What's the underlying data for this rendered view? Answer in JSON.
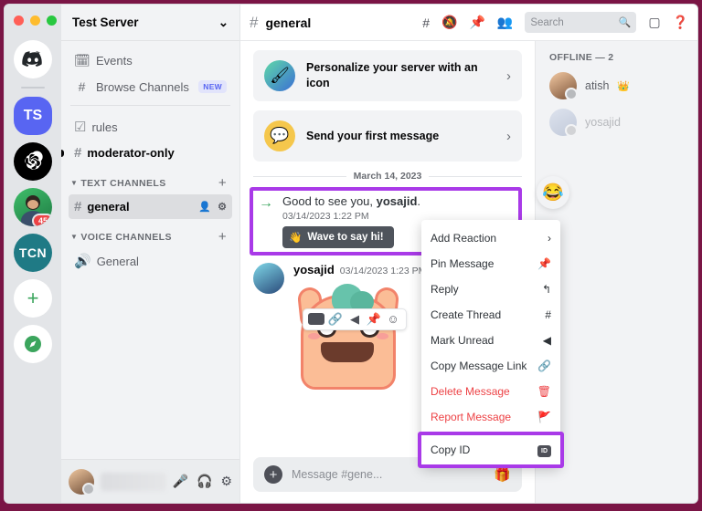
{
  "window": {
    "traffic_lights": [
      "close",
      "minimize",
      "maximize"
    ]
  },
  "rail": {
    "servers": [
      {
        "name": "discord-home",
        "label": "",
        "icon": "discord-logo"
      },
      {
        "name": "test-server",
        "label": "TS",
        "icon": "server-ts"
      },
      {
        "name": "chatgpt-server",
        "label": "",
        "icon": "openai-logo"
      },
      {
        "name": "avatar-server",
        "label": "",
        "icon": "avatar",
        "badge": "45"
      },
      {
        "name": "tcn-server",
        "label": "TCN",
        "icon": "server-tcn"
      },
      {
        "name": "add-server",
        "label": "+",
        "icon": "plus"
      },
      {
        "name": "explore-servers",
        "label": "",
        "icon": "compass"
      }
    ]
  },
  "sidebar": {
    "server_name": "Test Server",
    "nav": [
      {
        "label": "Events",
        "icon": "calendar-icon"
      },
      {
        "label": "Browse Channels",
        "icon": "browse-channels-icon",
        "tag": "NEW"
      }
    ],
    "top_channels": [
      {
        "label": "rules",
        "icon": "rules-icon",
        "unread": false
      },
      {
        "label": "moderator-only",
        "icon": "hash-lock-icon",
        "unread": true
      }
    ],
    "categories": [
      {
        "label": "TEXT CHANNELS",
        "channels": [
          {
            "label": "general",
            "icon": "hash-icon",
            "active": true
          }
        ]
      },
      {
        "label": "VOICE CHANNELS",
        "channels": [
          {
            "label": "General",
            "icon": "speaker-icon",
            "active": false
          }
        ]
      }
    ],
    "user_panel": {
      "username": "",
      "icons": [
        "mic-icon",
        "headphones-icon",
        "settings-icon"
      ]
    }
  },
  "topbar": {
    "hash": "#",
    "channel": "general",
    "icons": [
      "threads-icon",
      "notifications-off-icon",
      "pinned-messages-icon",
      "members-icon"
    ],
    "search_placeholder": "Search",
    "right_icons": [
      "inbox-icon",
      "help-icon"
    ]
  },
  "onboarding": [
    {
      "title": "Personalize your server with an icon",
      "icon": "paint-brush-icon"
    },
    {
      "title": "Send your first message",
      "icon": "chat-emoji-icon"
    }
  ],
  "messages": {
    "date_divider": "March 14, 2023",
    "system": {
      "text_prefix": "Good to see you, ",
      "username": "yosajid",
      "text_suffix": ".",
      "timestamp": "03/14/2023 1:22 PM",
      "button_label": "Wave to say hi!",
      "arrow_icon": "arrow-right-icon"
    },
    "hover_tools": [
      "copy-id-icon",
      "copy-link-icon",
      "mark-unread-icon",
      "pin-icon",
      "add-reaction-icon"
    ],
    "user_message": {
      "author": "yosajid",
      "timestamp": "03/14/2023 1:23 PM",
      "sticker": "cartoon-creature-sticker"
    }
  },
  "composer": {
    "placeholder": "Message #gene...",
    "plus_icon": "add-attachment-icon",
    "gift_icon": "gift-icon"
  },
  "members": {
    "category": "OFFLINE — 2",
    "list": [
      {
        "name": "atish",
        "crown": true,
        "offline": true
      },
      {
        "name": "yosajid",
        "crown": false,
        "offline": true
      }
    ]
  },
  "context_menu": {
    "emoji_button": "😂",
    "items": [
      {
        "label": "Add Reaction",
        "icon": "chevron-right-icon",
        "danger": false
      },
      {
        "label": "Pin Message",
        "icon": "pin-icon",
        "danger": false
      },
      {
        "label": "Reply",
        "icon": "reply-icon",
        "danger": false
      },
      {
        "label": "Create Thread",
        "icon": "thread-icon",
        "danger": false
      },
      {
        "label": "Mark Unread",
        "icon": "mark-unread-icon",
        "danger": false
      },
      {
        "label": "Copy Message Link",
        "icon": "link-icon",
        "danger": false
      },
      {
        "label": "Delete Message",
        "icon": "trash-icon",
        "danger": true
      },
      {
        "label": "Report Message",
        "icon": "flag-icon",
        "danger": true
      }
    ],
    "highlighted_item": {
      "label": "Copy ID",
      "icon": "id-icon"
    }
  },
  "colors": {
    "highlight": "#a93ae8",
    "accent": "#5865f2",
    "danger": "#ed4245",
    "online": "#3ba55d"
  }
}
